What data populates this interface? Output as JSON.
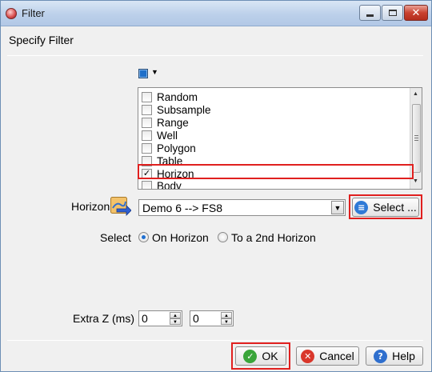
{
  "window": {
    "title": "Filter"
  },
  "header": {
    "label": "Specify Filter"
  },
  "filter_list": {
    "items": [
      {
        "label": "Random",
        "checked": false
      },
      {
        "label": "Subsample",
        "checked": false
      },
      {
        "label": "Range",
        "checked": false
      },
      {
        "label": "Well",
        "checked": false
      },
      {
        "label": "Polygon",
        "checked": false
      },
      {
        "label": "Table",
        "checked": false
      },
      {
        "label": "Horizon",
        "checked": true
      },
      {
        "label": "Body",
        "checked": false
      }
    ],
    "check_glyph": "✓"
  },
  "horizon": {
    "label": "Horizon",
    "selected": "Demo 6 --> FS8",
    "select_button": "Select ..."
  },
  "select_mode": {
    "label": "Select",
    "options": [
      "On Horizon",
      "To a 2nd Horizon"
    ],
    "selected": "On Horizon"
  },
  "extra_z": {
    "label": "Extra Z (ms)",
    "value1": "0",
    "value2": "0"
  },
  "footer": {
    "ok": "OK",
    "cancel": "Cancel",
    "help": "Help"
  },
  "colors": {
    "highlight": "#e0201f",
    "swatch": "#1f6fc9",
    "ok_icon": "#3aa53a",
    "cancel_icon": "#d9372b",
    "help_icon": "#2f6fce"
  }
}
